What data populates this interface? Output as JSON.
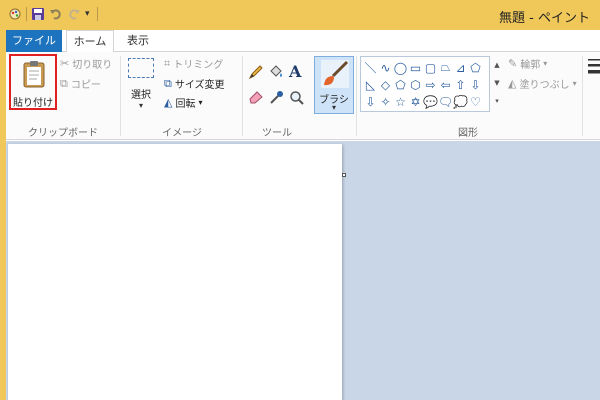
{
  "window": {
    "title": "無題 - ペイント"
  },
  "tabs": {
    "file": "ファイル",
    "home": "ホーム",
    "view": "表示"
  },
  "clipboard": {
    "paste": "貼り付け",
    "cut": "切り取り",
    "copy": "コピー",
    "group_label": "クリップボード"
  },
  "image": {
    "select": "選択",
    "crop": "トリミング",
    "resize": "サイズ変更",
    "rotate": "回転",
    "group_label": "イメージ"
  },
  "tools": {
    "group_label": "ツール"
  },
  "brush": {
    "label": "ブラシ"
  },
  "shapes": {
    "outline": "輪郭",
    "fill": "塗りつぶし",
    "group_label": "図形",
    "icons": [
      "＼",
      "∿",
      "◯",
      "▭",
      "▢",
      "⏢",
      "⊿",
      "⬠",
      "◺",
      "◇",
      "⬠",
      "⬡",
      "⇨",
      "⇦",
      "⇧",
      "⇩",
      "⇩",
      "✧",
      "☆",
      "✡",
      "💬",
      "🗨",
      "💭",
      "♡"
    ]
  },
  "colors": {
    "titlebar": "#f0c85a",
    "file_tab": "#1e73be",
    "paste_highlight": "#e02020",
    "canvas_bg": "#c8d6e8"
  }
}
